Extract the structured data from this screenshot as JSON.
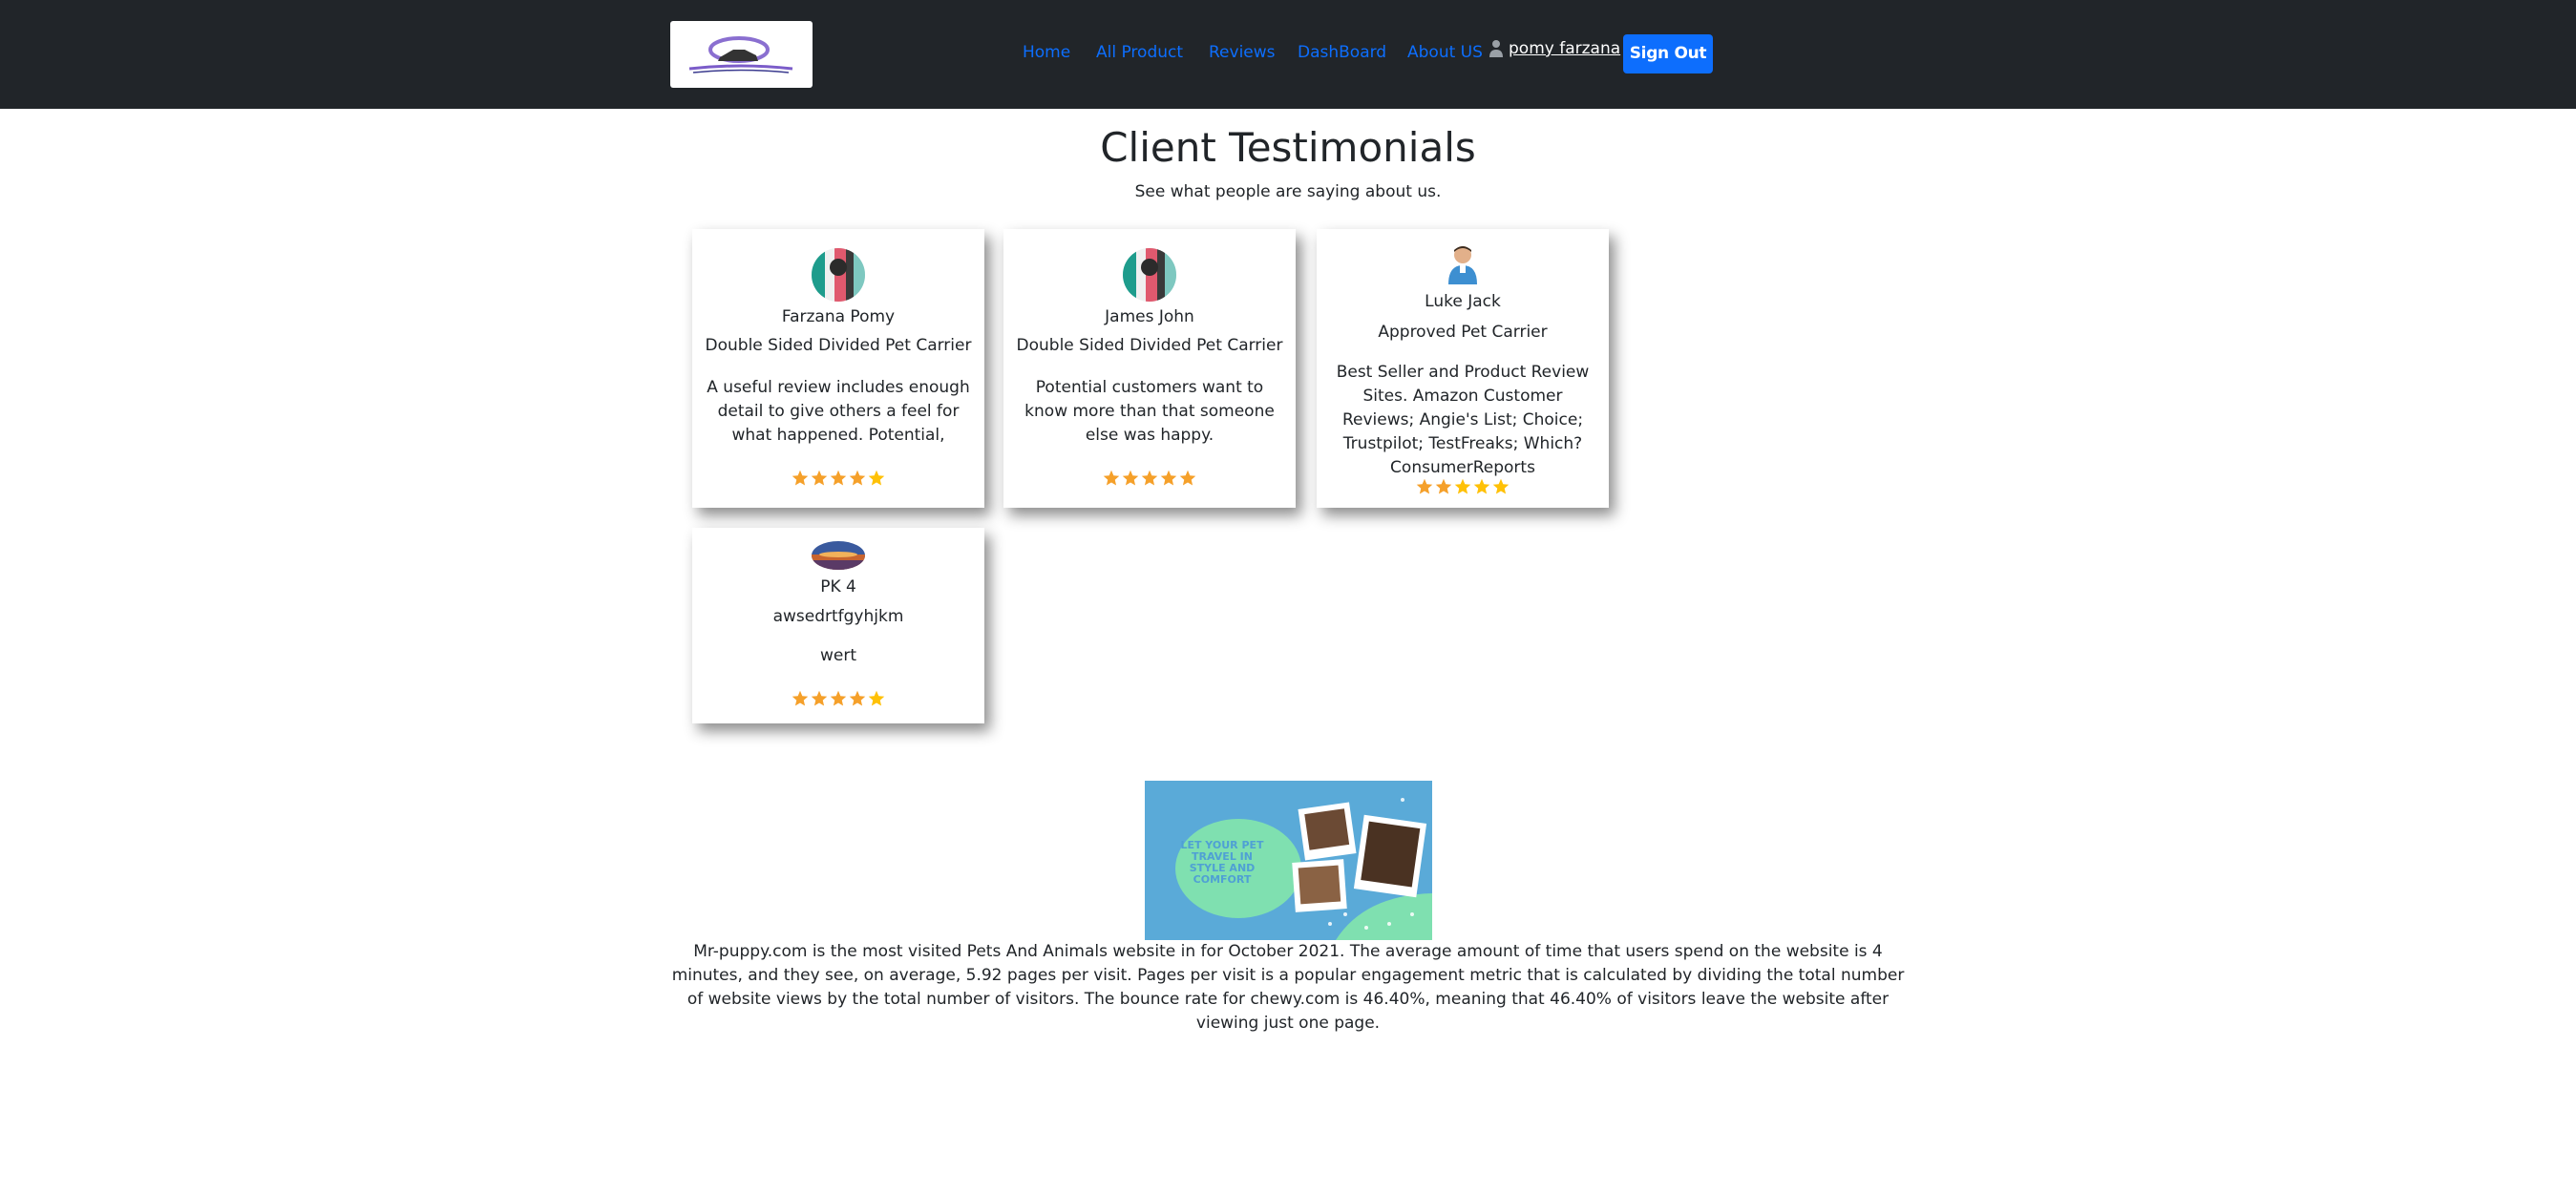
{
  "nav": {
    "links": [
      "Home",
      "All Product",
      "Reviews",
      "DashBoard",
      "About US"
    ],
    "user_name": "pomy farzana",
    "signout_label": "Sign Out"
  },
  "header": {
    "title": "Client Testimonials",
    "subtitle": "See what people are saying about us."
  },
  "testimonials": [
    {
      "name": "Farzana Pomy",
      "product": "Double Sided Divided Pet Carrier",
      "review": "A useful review includes enough detail to give others a feel for what happened. Potential,",
      "rating": 5
    },
    {
      "name": "James John",
      "product": "Double Sided Divided Pet Carrier",
      "review": "Potential customers want to know more than that someone else was happy.",
      "rating": 5
    },
    {
      "name": "Luke Jack",
      "product": "Approved Pet Carrier",
      "review": "Best Seller and Product Review Sites. Amazon Customer Reviews; Angie's List; Choice; Trustpilot; TestFreaks; Which? ConsumerReports",
      "rating": 5
    },
    {
      "name": "PK 4",
      "product": "awsedrtfgyhjkm",
      "review": "wert",
      "rating": 5
    }
  ],
  "promo": {
    "text": "LET YOUR PET TRAVEL IN STYLE AND COMFORT"
  },
  "about_text": "Mr-puppy.com is the most visited Pets And Animals website in for October 2021. The average amount of time that users spend on the website is 4 minutes, and they see, on average, 5.92 pages per visit. Pages per visit is a popular engagement metric that is calculated by dividing the total number of website views by the total number of visitors. The bounce rate for chewy.com is 46.40%, meaning that 46.40% of visitors leave the website after viewing just one page.",
  "colors": {
    "navbar": "#212529",
    "link": "#0d6efd",
    "button": "#0d6efd",
    "star": "#f5a623"
  }
}
